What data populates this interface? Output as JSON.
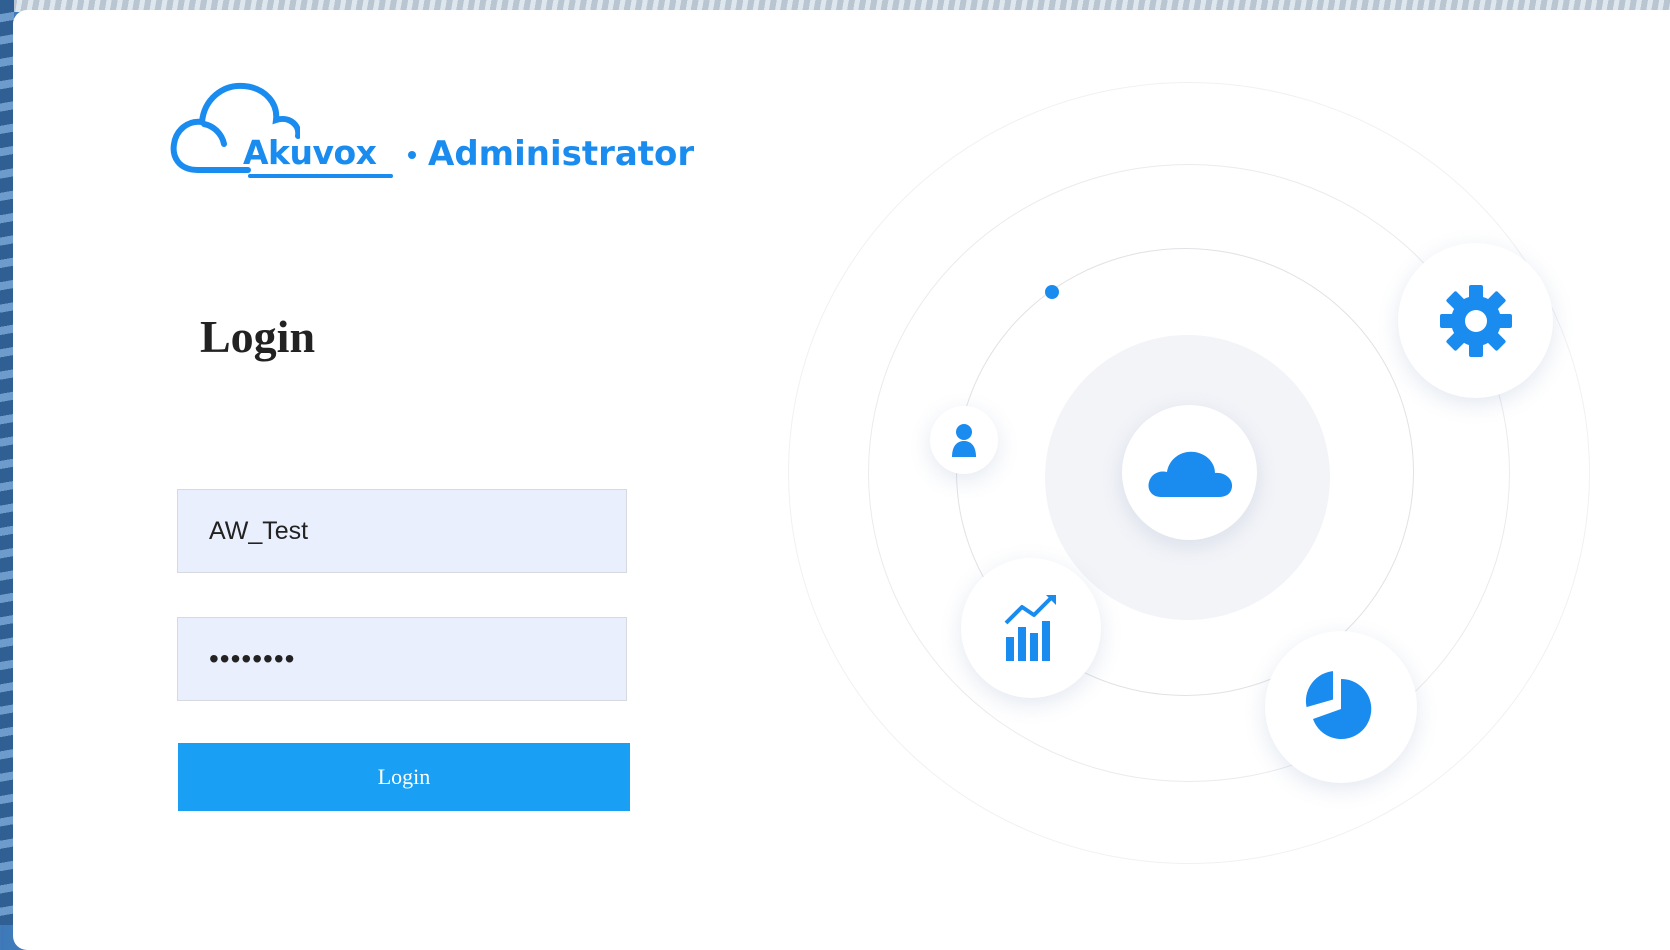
{
  "brand": {
    "name": "Akuvox",
    "suffix": "Administrator",
    "color": "#1a8cf0"
  },
  "form": {
    "title": "Login",
    "username_value": "AW_Test",
    "password_masked": "••••••••",
    "login_button_label": "Login",
    "button_color": "#19a0f5",
    "field_background": "#e9effd"
  },
  "illustration": {
    "icons": [
      "cloud-icon",
      "gear-icon",
      "user-icon",
      "bar-chart-icon",
      "pie-chart-icon"
    ]
  }
}
